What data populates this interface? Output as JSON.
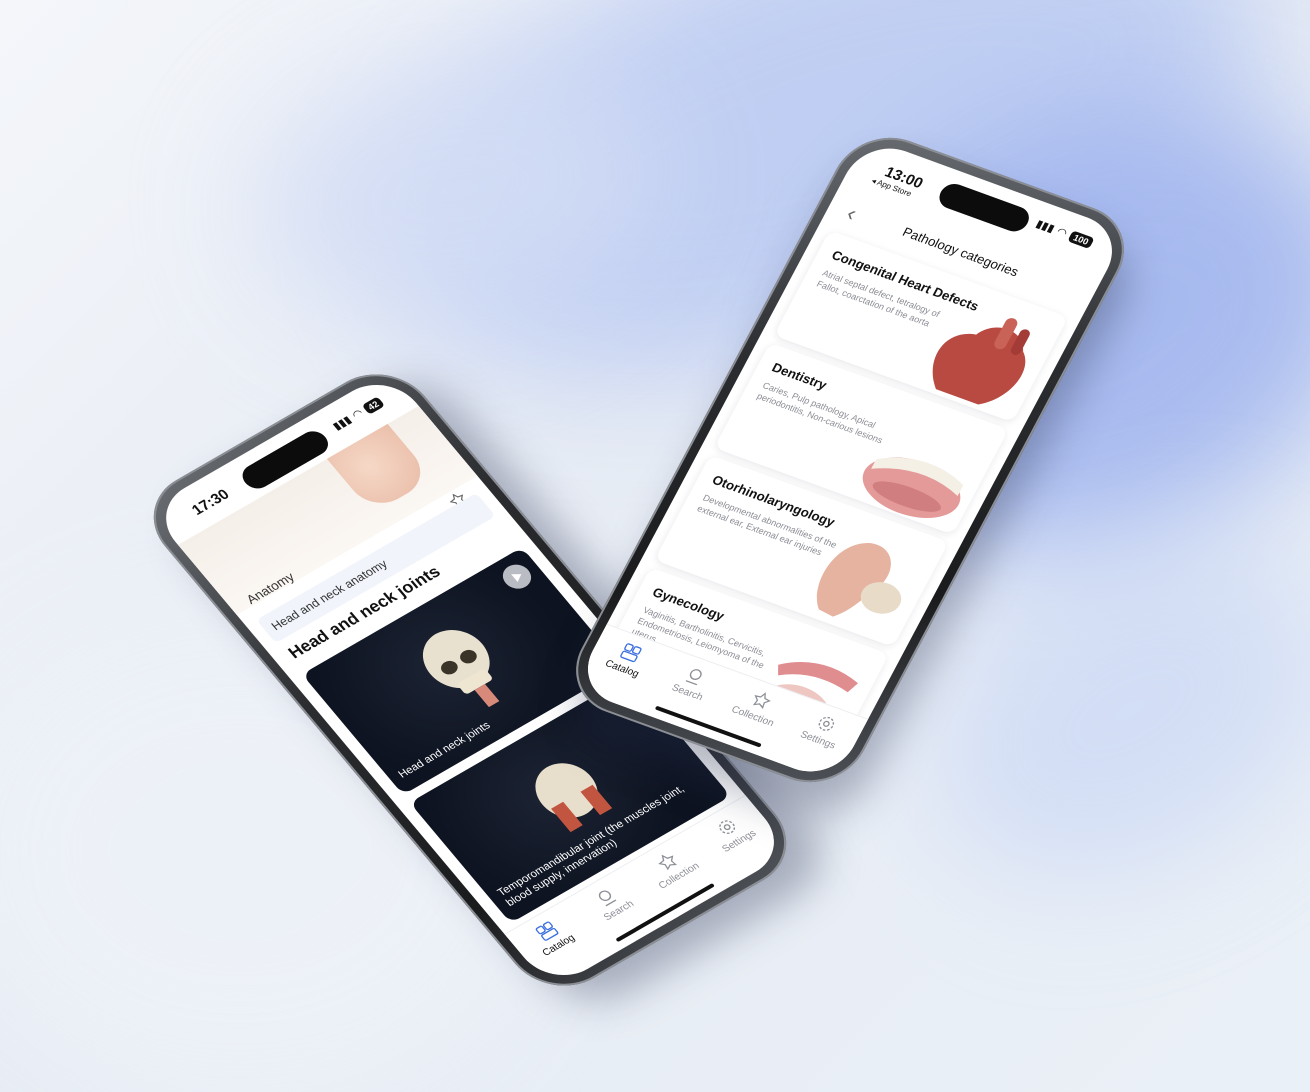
{
  "left_phone": {
    "time": "17:30",
    "battery": "42",
    "breadcrumb": "Anatomy",
    "subtitle": "Head and neck anatomy",
    "title": "Head and neck joints",
    "cards": [
      {
        "caption": "Head and neck joints"
      },
      {
        "caption": "Temporomandibular joint (the muscles joint, blood supply, innervation)"
      },
      {
        "caption": ""
      }
    ],
    "tabs": [
      "Catalog",
      "Search",
      "Collection",
      "Settings"
    ]
  },
  "right_phone": {
    "time": "13:00",
    "back_app": "◂ App Store",
    "battery": "100",
    "title": "Pathology categories",
    "categories": [
      {
        "name": "Congenital Heart Defects",
        "desc": "Atrial septal defect, tetralogy of Fallot, coarctation of the aorta"
      },
      {
        "name": "Dentistry",
        "desc": "Caries, Pulp pathology, Apical periodontitis, Non-carious lesions"
      },
      {
        "name": "Otorhinolaryngology",
        "desc": "Developmental abnormalities of the external ear, External ear injuries"
      },
      {
        "name": "Gynecology",
        "desc": "Vaginitis, Bartholinitis, Cervicitis, Endometriosis, Leiomyoma of the uterus"
      }
    ],
    "tabs": [
      "Catalog",
      "Search",
      "Collection",
      "Settings"
    ]
  },
  "icons": [
    "catalog-icon",
    "search-icon",
    "star-icon",
    "gear-icon",
    "play-icon",
    "back-chevron-icon"
  ]
}
